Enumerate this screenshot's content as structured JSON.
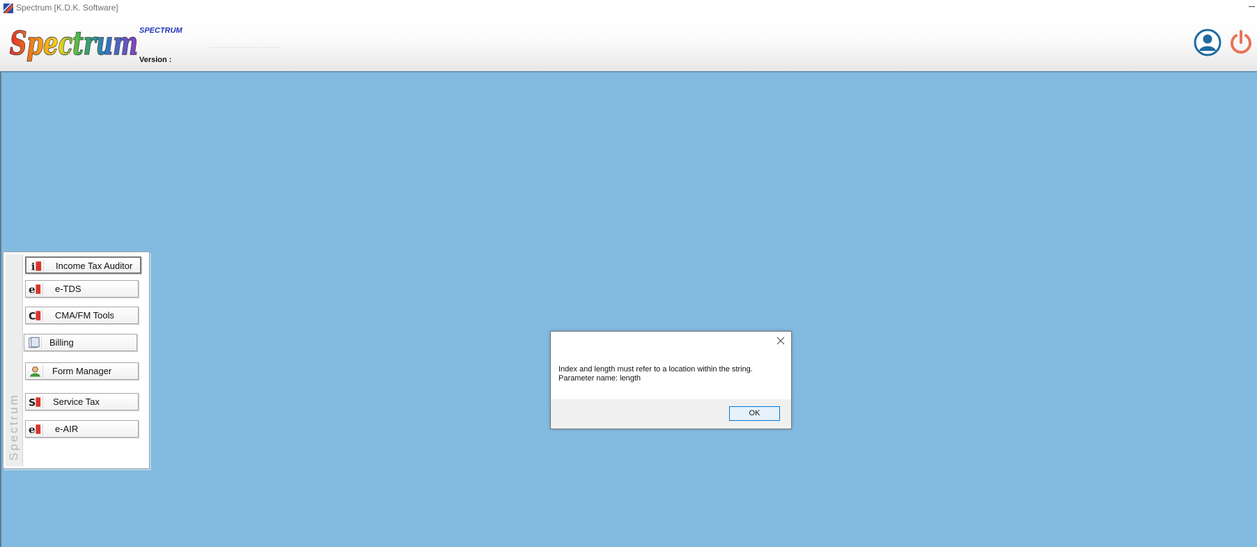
{
  "window": {
    "title": "Spectrum [K.D.K. Software]"
  },
  "header": {
    "logo_text": "Spectrum",
    "brand": "SPECTRUM",
    "version_label": "Version :"
  },
  "side_panel": {
    "strip_label": "Spectrum",
    "modules": [
      {
        "label": "Income Tax Auditor",
        "icon": "income-tax-auditor-icon"
      },
      {
        "label": "e-TDS",
        "icon": "etds-icon"
      },
      {
        "label": "CMA/FM Tools",
        "icon": "cma-fm-tools-icon"
      },
      {
        "label": "Billing",
        "icon": "billing-icon"
      },
      {
        "label": "Form Manager",
        "icon": "form-manager-icon"
      },
      {
        "label": "Service Tax",
        "icon": "service-tax-icon"
      },
      {
        "label": "e-AIR",
        "icon": "eair-icon"
      }
    ]
  },
  "dialog": {
    "message_line1": "Index and length must refer to a location within the string.",
    "message_line2": "Parameter name: length",
    "ok_label": "OK"
  },
  "colors": {
    "desktop": "#83badf",
    "brand": "#2233bb",
    "power": "#e8735a",
    "user": "#1f6aa0"
  }
}
